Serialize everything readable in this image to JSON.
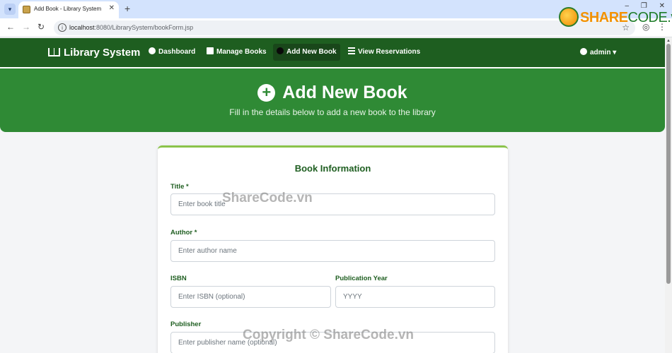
{
  "browser": {
    "tab_title": "Add Book - Library System",
    "tab_close": "✕",
    "new_tab": "+",
    "window_controls": [
      "–",
      "❐",
      "✕"
    ],
    "url_host": "localhost",
    "url_path": ":8080/LibrarySystem/bookForm.jsp"
  },
  "watermark_logo": {
    "part1": "SHARE",
    "part2": "CODE.vn"
  },
  "navbar": {
    "brand": "Library System",
    "items": [
      {
        "label": "Dashboard",
        "icon": "dashboard-icon"
      },
      {
        "label": "Manage Books",
        "icon": "book-icon"
      },
      {
        "label": "Add New Book",
        "icon": "plus-circle-icon",
        "active": true
      },
      {
        "label": "View Reservations",
        "icon": "list-icon"
      }
    ],
    "user": "admin"
  },
  "hero": {
    "title": "Add New Book",
    "subtitle": "Fill in the details below to add a new book to the library"
  },
  "form": {
    "heading": "Book Information",
    "title_label": "Title *",
    "title_placeholder": "Enter book title",
    "author_label": "Author *",
    "author_placeholder": "Enter author name",
    "isbn_label": "ISBN",
    "isbn_placeholder": "Enter ISBN (optional)",
    "year_label": "Publication Year",
    "year_placeholder": "YYYY",
    "publisher_label": "Publisher",
    "publisher_placeholder": "Enter publisher name (optional)"
  },
  "watermarks": {
    "center": "ShareCode.vn",
    "bottom": "Copyright © ShareCode.vn"
  },
  "colors": {
    "nav_bg": "#1e5e20",
    "hero_bg": "#2f8a35",
    "accent": "#8bc34a",
    "label": "#1e5e20"
  }
}
